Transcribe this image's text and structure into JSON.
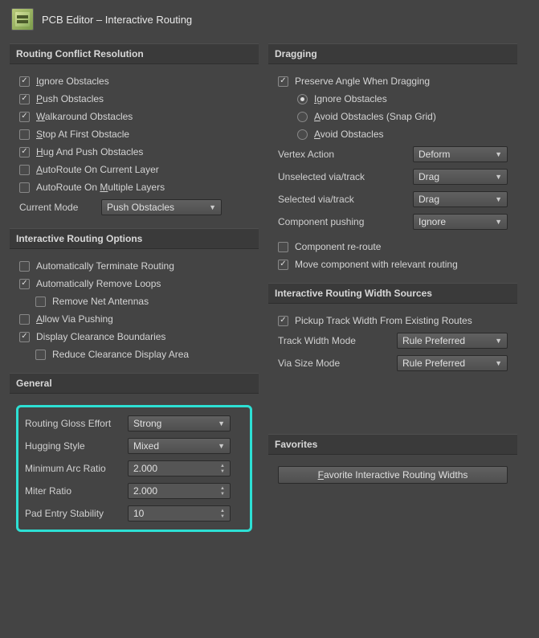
{
  "header": {
    "title": "PCB Editor – Interactive Routing"
  },
  "conflict": {
    "title": "Routing Conflict Resolution",
    "ignore": "Ignore Obstacles",
    "push": "Push Obstacles",
    "walk": "Walkaround Obstacles",
    "stop": "Stop At First Obstacle",
    "hug": "Hug And Push Obstacles",
    "autoroute_current": "AutoRoute On Current Layer",
    "autoroute_multi": "AutoRoute On Multiple Layers",
    "current_mode_label": "Current Mode",
    "current_mode_value": "Push Obstacles"
  },
  "dragging": {
    "title": "Dragging",
    "preserve": "Preserve Angle When Dragging",
    "radio_ignore": "Ignore Obstacles",
    "radio_avoid_snap": "Avoid Obstacles (Snap Grid)",
    "radio_avoid": "Avoid Obstacles",
    "vertex_label": "Vertex Action",
    "vertex_value": "Deform",
    "unsel_label": "Unselected via/track",
    "unsel_value": "Drag",
    "sel_label": "Selected via/track",
    "sel_value": "Drag",
    "comp_push_label": "Component pushing",
    "comp_push_value": "Ignore",
    "comp_reroute": "Component re-route",
    "move_comp": "Move component with relevant routing"
  },
  "options": {
    "title": "Interactive Routing Options",
    "auto_term": "Automatically Terminate Routing",
    "auto_loops": "Automatically Remove Loops",
    "remove_net": "Remove Net Antennas",
    "allow_via": "Allow Via Pushing",
    "display_clear": "Display Clearance Boundaries",
    "reduce_clear": "Reduce Clearance Display Area"
  },
  "width": {
    "title": "Interactive Routing Width Sources",
    "pickup": "Pickup Track Width From Existing Routes",
    "track_label": "Track Width Mode",
    "track_value": "Rule Preferred",
    "via_label": "Via Size Mode",
    "via_value": "Rule Preferred"
  },
  "general": {
    "title": "General",
    "gloss_label": "Routing Gloss Effort",
    "gloss_value": "Strong",
    "hugging_label": "Hugging Style",
    "hugging_value": "Mixed",
    "minarc_label": "Minimum Arc Ratio",
    "minarc_value": "2.000",
    "miter_label": "Miter Ratio",
    "miter_value": "2.000",
    "pad_label": "Pad Entry Stability",
    "pad_value": "10"
  },
  "favorites": {
    "title": "Favorites",
    "button": "Favorite Interactive Routing Widths"
  }
}
